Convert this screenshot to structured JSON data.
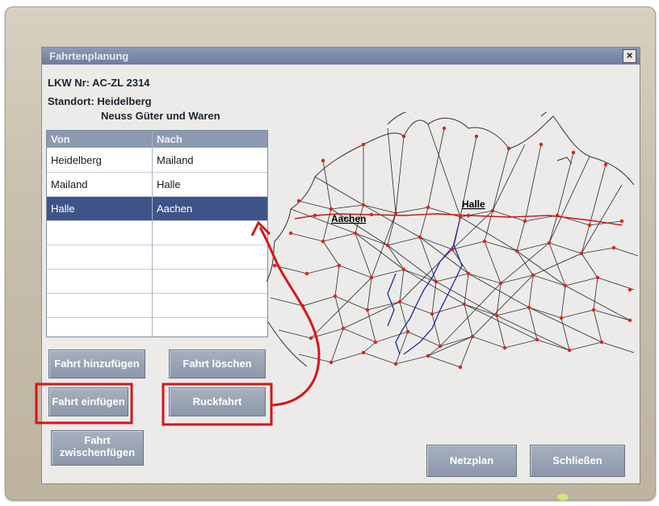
{
  "dialog": {
    "title": "Fahrtenplanung",
    "close_label": "×",
    "truck_label": "LKW Nr: AC-ZL 2314",
    "location_label": "Standort: Heidelberg",
    "company": "Neuss Güter und Waren"
  },
  "table": {
    "columns": [
      "Von",
      "Nach"
    ],
    "rows": [
      {
        "von": "Heidelberg",
        "nach": "Mailand"
      },
      {
        "von": "Mailand",
        "nach": "Halle"
      },
      {
        "von": "Halle",
        "nach": "Aachen",
        "selected": true
      }
    ],
    "empty_rows": 5
  },
  "buttons": {
    "add": "Fahrt hinzufügen",
    "delete": "Fahrt löschen",
    "insert": "Fahrt einfügen",
    "return": "Ruckfahrt",
    "between_line1": "Fahrt",
    "between_line2": "zwischenfügen",
    "network": "Netzplan",
    "close": "Schließen"
  },
  "map": {
    "labels": {
      "aachen": "Aachen",
      "halle": "Halle"
    },
    "colors": {
      "network": "#333333",
      "route": "#1a2aa8",
      "nodes": "#e0201c",
      "highlight": "#cc1111"
    }
  },
  "annotation": {
    "color": "#d8141a"
  }
}
